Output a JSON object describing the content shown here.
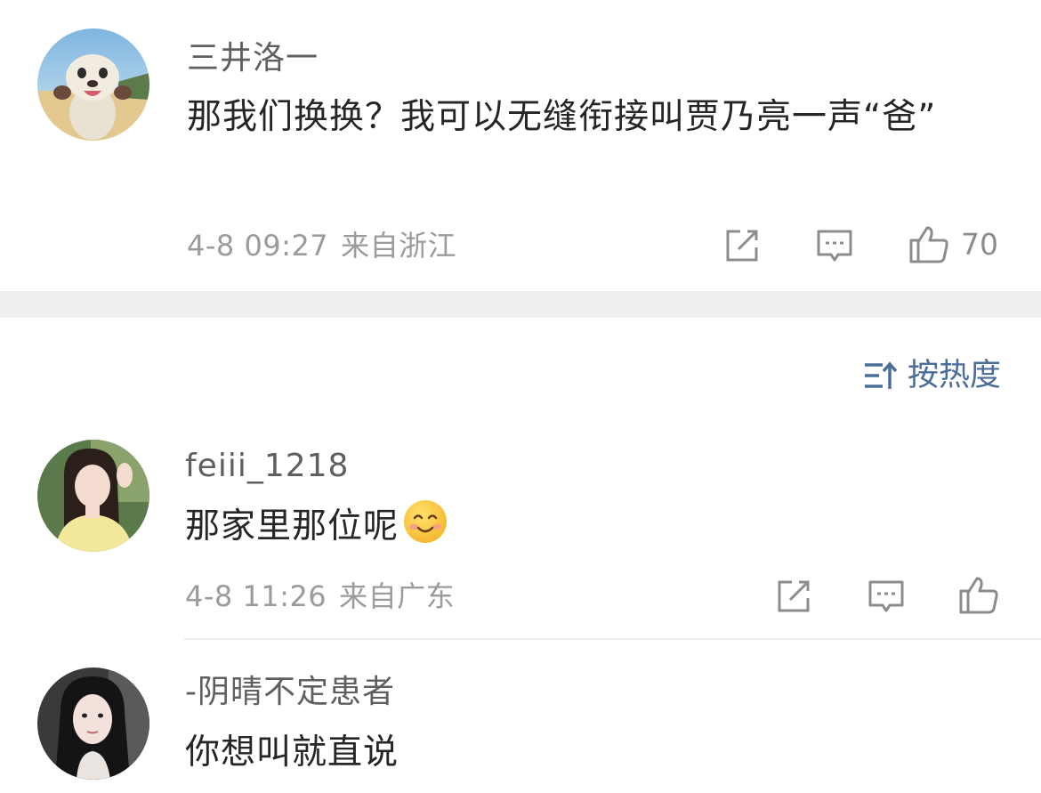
{
  "comments": [
    {
      "username": "三井洛一",
      "text": "那我们换换？我可以无缝衔接叫贾乃亮一声“爸”",
      "time": "4-8 09:27",
      "location": "来自浙江",
      "likes": "70",
      "avatar": "otter-avatar"
    },
    {
      "username": "feiii_1218",
      "text": "那家里那位呢",
      "emoji": "smiling-face-emoji",
      "time": "4-8 11:26",
      "location": "来自广东",
      "avatar": "girl-yellow-avatar"
    },
    {
      "username": "-阴晴不定患者",
      "text": "你想叫就直说",
      "avatar": "girl-dark-hair-avatar"
    }
  ],
  "sort": {
    "label": "按热度",
    "icon": "sort-icon"
  },
  "colors": {
    "username": "#5f5f5f",
    "text": "#262626",
    "meta": "#9b9b9b",
    "accent": "#4a6d99",
    "separator": "#efefef"
  }
}
